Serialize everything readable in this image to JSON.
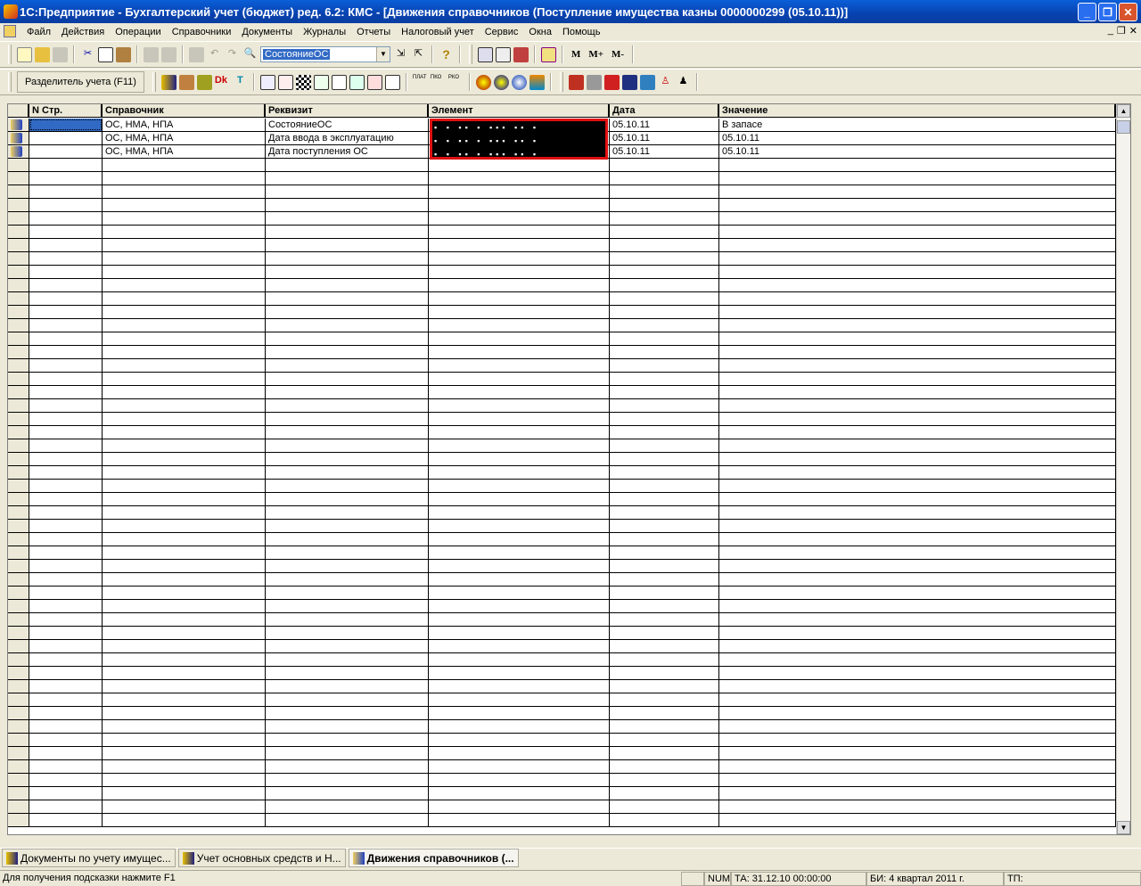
{
  "title": "1С:Предприятие - Бухгалтерский учет (бюджет) ред. 6.2:  КМС - [Движения справочников (Поступление имущества казны 0000000299 (05.10.11))]",
  "menu": [
    "Файл",
    "Действия",
    "Операции",
    "Справочники",
    "Документы",
    "Журналы",
    "Отчеты",
    "Налоговый учет",
    "Сервис",
    "Окна",
    "Помощь"
  ],
  "toolbar": {
    "search_value": "СостояниеОС",
    "m": "M",
    "m_plus": "M+",
    "m_minus": "M-",
    "separator_button": "Разделитель учета (F11)"
  },
  "table": {
    "columns": [
      "N Стр.",
      "Справочник",
      "Реквизит",
      "Элемент",
      "Дата",
      "Значение"
    ],
    "rows": [
      {
        "n": "",
        "ref": "ОС, НМА, НПА",
        "attr": "СостояниеОС",
        "elem": "",
        "date": "05.10.11",
        "value": "В запасе"
      },
      {
        "n": "",
        "ref": "ОС, НМА, НПА",
        "attr": "Дата ввода в эксплуатацию",
        "elem": "",
        "date": "05.10.11",
        "value": "05.10.11"
      },
      {
        "n": "",
        "ref": "ОС, НМА, НПА",
        "attr": "Дата поступления ОС",
        "elem": "",
        "date": "05.10.11",
        "value": "05.10.11"
      }
    ]
  },
  "tasks": [
    "Документы по учету имущес...",
    "Учет основных средств и Н...",
    "Движения справочников (..."
  ],
  "status": {
    "hint": "Для получения подсказки нажмите F1",
    "num": "NUM",
    "ta": "ТА: 31.12.10  00:00:00",
    "bi": "БИ: 4 квартал 2011 г.",
    "tp": "ТП:"
  }
}
